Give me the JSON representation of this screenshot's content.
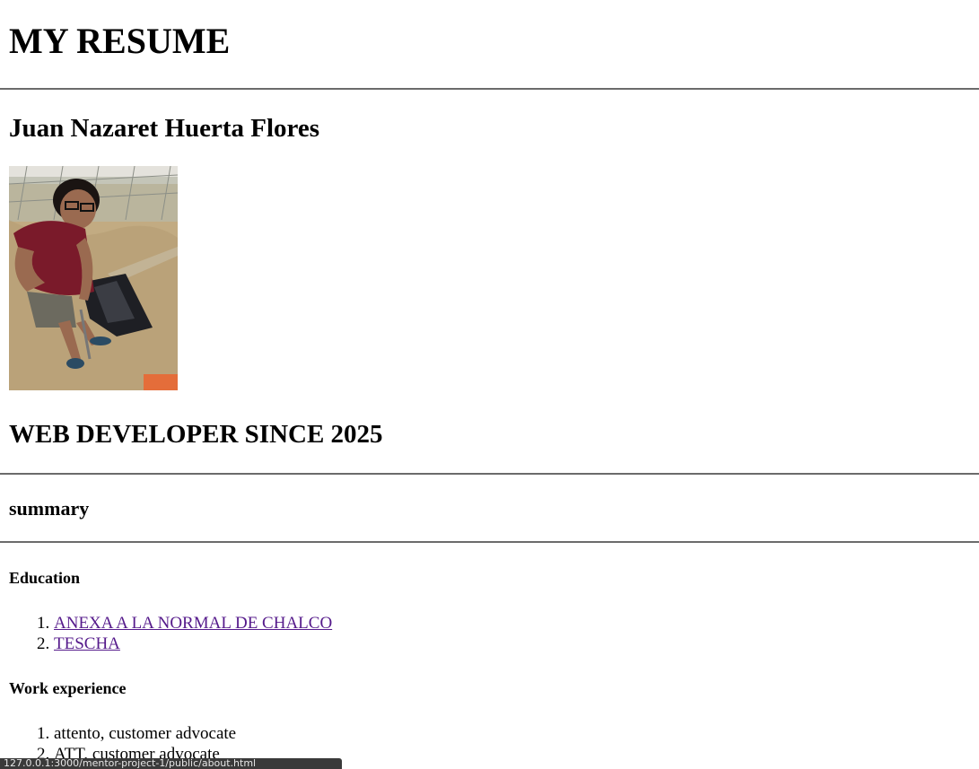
{
  "header": {
    "title": "MY RESUME"
  },
  "profile": {
    "name": "Juan Nazaret Huerta Flores",
    "photo_alt": "photo-icon",
    "role": "WEB DEVELOPER SINCE 2025"
  },
  "summary": {
    "heading": "summary"
  },
  "education": {
    "heading": "Education",
    "items": [
      {
        "label": "ANEXA A LA NORMAL DE CHALCO"
      },
      {
        "label": "TESCHA"
      }
    ]
  },
  "work": {
    "heading": "Work experience",
    "items": [
      {
        "label": "attento, customer advocate"
      },
      {
        "label": "ATT, customer advocate"
      }
    ]
  },
  "status_bar": {
    "url": "127.0.0.1:3000/mentor-project-1/public/about.html"
  },
  "colors": {
    "link_visited": "#551a8b",
    "rule": "#6b6b6b"
  }
}
